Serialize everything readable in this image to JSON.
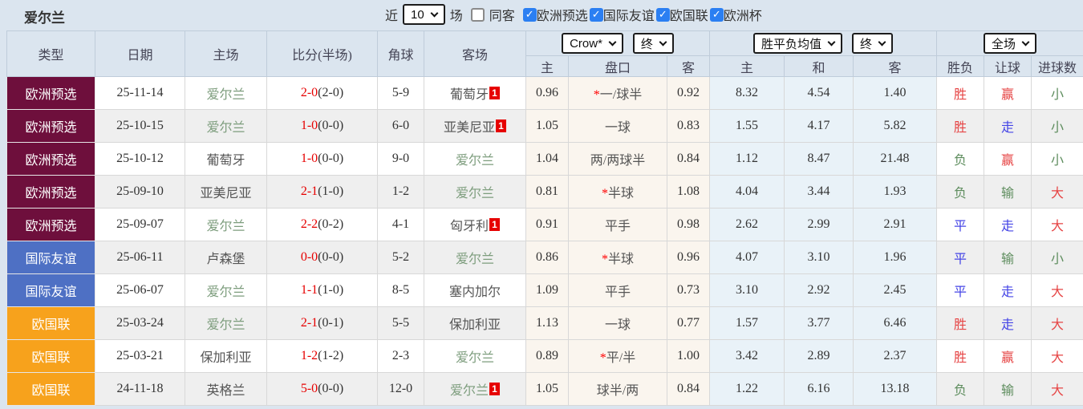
{
  "topbar": {
    "team": "爱尔兰",
    "recent_label": "近",
    "recent_value": "10",
    "matches_label": "场",
    "same_away_label": "同客",
    "filters": [
      {
        "label": "欧洲预选",
        "checked": true
      },
      {
        "label": "国际友谊",
        "checked": true
      },
      {
        "label": "欧国联",
        "checked": true
      },
      {
        "label": "欧洲杯",
        "checked": true
      }
    ]
  },
  "header": {
    "cols": [
      "类型",
      "日期",
      "主场",
      "比分(半场)",
      "角球",
      "客场"
    ],
    "odds_company_select": "Crow*",
    "odds_time_select": "终",
    "odds_sub": [
      "主",
      "盘口",
      "客"
    ],
    "avg_select": "胜平负均值",
    "avg_time_select": "终",
    "avg_sub": [
      "主",
      "和",
      "客"
    ],
    "scope_select": "全场",
    "result_sub": [
      "胜负",
      "让球",
      "进球数"
    ]
  },
  "palette": {
    "red": "#e64444",
    "blue": "#4444e6",
    "green": "#5e8d5e",
    "score_red": "#e60000",
    "star_red": "#ff0000",
    "ireland_green": "#7d9d7d",
    "team_gray": "#555555",
    "badge_bg": "#e60000",
    "checkbox_blue": "#2b7ff2",
    "type_euro_qual": "#6e0f3c",
    "type_friendly": "#4e70c4",
    "type_nations": "#f7a21c"
  },
  "rows": [
    {
      "type": "欧洲预选",
      "type_color_key": "type_euro_qual",
      "date": "25-11-14",
      "home": "爱尔兰",
      "home_ireland": true,
      "home_badge": "",
      "score": "2-0",
      "half": "(2-0)",
      "corner": "5-9",
      "away": "葡萄牙",
      "away_ireland": false,
      "away_badge": "1",
      "odds": [
        "0.96",
        "*一/球半",
        "0.92"
      ],
      "avg": [
        "8.32",
        "4.54",
        "1.40"
      ],
      "result": {
        "t": "胜",
        "c": "red"
      },
      "let": {
        "t": "赢",
        "c": "red"
      },
      "goals": {
        "t": "小",
        "c": "green"
      }
    },
    {
      "type": "欧洲预选",
      "type_color_key": "type_euro_qual",
      "date": "25-10-15",
      "home": "爱尔兰",
      "home_ireland": true,
      "home_badge": "",
      "score": "1-0",
      "half": "(0-0)",
      "corner": "6-0",
      "away": "亚美尼亚",
      "away_ireland": false,
      "away_badge": "1",
      "odds": [
        "1.05",
        "一球",
        "0.83"
      ],
      "avg": [
        "1.55",
        "4.17",
        "5.82"
      ],
      "result": {
        "t": "胜",
        "c": "red"
      },
      "let": {
        "t": "走",
        "c": "blue"
      },
      "goals": {
        "t": "小",
        "c": "green"
      }
    },
    {
      "type": "欧洲预选",
      "type_color_key": "type_euro_qual",
      "date": "25-10-12",
      "home": "葡萄牙",
      "home_ireland": false,
      "home_badge": "",
      "score": "1-0",
      "half": "(0-0)",
      "corner": "9-0",
      "away": "爱尔兰",
      "away_ireland": true,
      "away_badge": "",
      "odds": [
        "1.04",
        "两/两球半",
        "0.84"
      ],
      "avg": [
        "1.12",
        "8.47",
        "21.48"
      ],
      "result": {
        "t": "负",
        "c": "green"
      },
      "let": {
        "t": "赢",
        "c": "red"
      },
      "goals": {
        "t": "小",
        "c": "green"
      }
    },
    {
      "type": "欧洲预选",
      "type_color_key": "type_euro_qual",
      "date": "25-09-10",
      "home": "亚美尼亚",
      "home_ireland": false,
      "home_badge": "",
      "score": "2-1",
      "half": "(1-0)",
      "corner": "1-2",
      "away": "爱尔兰",
      "away_ireland": true,
      "away_badge": "",
      "odds": [
        "0.81",
        "*半球",
        "1.08"
      ],
      "avg": [
        "4.04",
        "3.44",
        "1.93"
      ],
      "result": {
        "t": "负",
        "c": "green"
      },
      "let": {
        "t": "输",
        "c": "green"
      },
      "goals": {
        "t": "大",
        "c": "red"
      }
    },
    {
      "type": "欧洲预选",
      "type_color_key": "type_euro_qual",
      "date": "25-09-07",
      "home": "爱尔兰",
      "home_ireland": true,
      "home_badge": "",
      "score": "2-2",
      "half": "(0-2)",
      "corner": "4-1",
      "away": "匈牙利",
      "away_ireland": false,
      "away_badge": "1",
      "odds": [
        "0.91",
        "平手",
        "0.98"
      ],
      "avg": [
        "2.62",
        "2.99",
        "2.91"
      ],
      "result": {
        "t": "平",
        "c": "blue"
      },
      "let": {
        "t": "走",
        "c": "blue"
      },
      "goals": {
        "t": "大",
        "c": "red"
      }
    },
    {
      "type": "国际友谊",
      "type_color_key": "type_friendly",
      "date": "25-06-11",
      "home": "卢森堡",
      "home_ireland": false,
      "home_badge": "",
      "score": "0-0",
      "half": "(0-0)",
      "corner": "5-2",
      "away": "爱尔兰",
      "away_ireland": true,
      "away_badge": "",
      "odds": [
        "0.86",
        "*半球",
        "0.96"
      ],
      "avg": [
        "4.07",
        "3.10",
        "1.96"
      ],
      "result": {
        "t": "平",
        "c": "blue"
      },
      "let": {
        "t": "输",
        "c": "green"
      },
      "goals": {
        "t": "小",
        "c": "green"
      }
    },
    {
      "type": "国际友谊",
      "type_color_key": "type_friendly",
      "date": "25-06-07",
      "home": "爱尔兰",
      "home_ireland": true,
      "home_badge": "",
      "score": "1-1",
      "half": "(1-0)",
      "corner": "8-5",
      "away": "塞内加尔",
      "away_ireland": false,
      "away_badge": "",
      "odds": [
        "1.09",
        "平手",
        "0.73"
      ],
      "avg": [
        "3.10",
        "2.92",
        "2.45"
      ],
      "result": {
        "t": "平",
        "c": "blue"
      },
      "let": {
        "t": "走",
        "c": "blue"
      },
      "goals": {
        "t": "大",
        "c": "red"
      }
    },
    {
      "type": "欧国联",
      "type_color_key": "type_nations",
      "date": "25-03-24",
      "home": "爱尔兰",
      "home_ireland": true,
      "home_badge": "",
      "score": "2-1",
      "half": "(0-1)",
      "corner": "5-5",
      "away": "保加利亚",
      "away_ireland": false,
      "away_badge": "",
      "odds": [
        "1.13",
        "一球",
        "0.77"
      ],
      "avg": [
        "1.57",
        "3.77",
        "6.46"
      ],
      "result": {
        "t": "胜",
        "c": "red"
      },
      "let": {
        "t": "走",
        "c": "blue"
      },
      "goals": {
        "t": "大",
        "c": "red"
      }
    },
    {
      "type": "欧国联",
      "type_color_key": "type_nations",
      "date": "25-03-21",
      "home": "保加利亚",
      "home_ireland": false,
      "home_badge": "",
      "score": "1-2",
      "half": "(1-2)",
      "corner": "2-3",
      "away": "爱尔兰",
      "away_ireland": true,
      "away_badge": "",
      "odds": [
        "0.89",
        "*平/半",
        "1.00"
      ],
      "avg": [
        "3.42",
        "2.89",
        "2.37"
      ],
      "result": {
        "t": "胜",
        "c": "red"
      },
      "let": {
        "t": "赢",
        "c": "red"
      },
      "goals": {
        "t": "大",
        "c": "red"
      }
    },
    {
      "type": "欧国联",
      "type_color_key": "type_nations",
      "date": "24-11-18",
      "home": "英格兰",
      "home_ireland": false,
      "home_badge": "",
      "score": "5-0",
      "half": "(0-0)",
      "corner": "12-0",
      "away": "爱尔兰",
      "away_ireland": true,
      "away_badge": "1",
      "odds": [
        "1.05",
        "球半/两",
        "0.84"
      ],
      "avg": [
        "1.22",
        "6.16",
        "13.18"
      ],
      "result": {
        "t": "负",
        "c": "green"
      },
      "let": {
        "t": "输",
        "c": "green"
      },
      "goals": {
        "t": "大",
        "c": "red"
      }
    }
  ]
}
